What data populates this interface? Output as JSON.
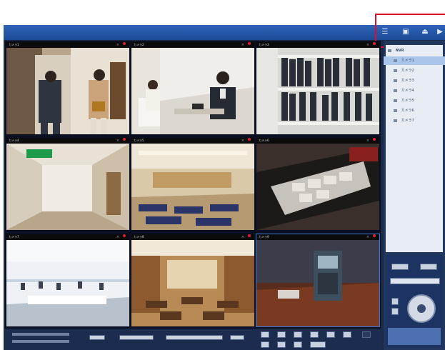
{
  "toolbar": {
    "icons": [
      "list-icon",
      "window-icon",
      "eject-icon",
      "play-icon"
    ],
    "list_glyph": "☰",
    "window_glyph": "▣",
    "eject_glyph": "⏏",
    "play_glyph": "▶"
  },
  "colors": {
    "titlebar": "#2f63b8",
    "highlight_border": "#d8102a",
    "recording": "#e0202a",
    "panel": "#22375c"
  },
  "cameras": [
    {
      "label": "カメラ1",
      "scene": "office corridor"
    },
    {
      "label": "カメラ2",
      "scene": "reception desk"
    },
    {
      "label": "カメラ3",
      "scene": "document shelves"
    },
    {
      "label": "カメラ4",
      "scene": "emergency exit hallway"
    },
    {
      "label": "カメラ5",
      "scene": "lobby seating"
    },
    {
      "label": "カメラ6",
      "scene": "cash drawer"
    },
    {
      "label": "カメラ7",
      "scene": "open office"
    },
    {
      "label": "カメラ8",
      "scene": "restaurant"
    },
    {
      "label": "カメラ9",
      "scene": "telephone booth"
    }
  ],
  "tree": {
    "root": "NVR",
    "items": [
      "カメラ1",
      "カメラ2",
      "カメラ3",
      "カメラ4",
      "カメラ5",
      "カメラ6",
      "カメラ7"
    ]
  }
}
